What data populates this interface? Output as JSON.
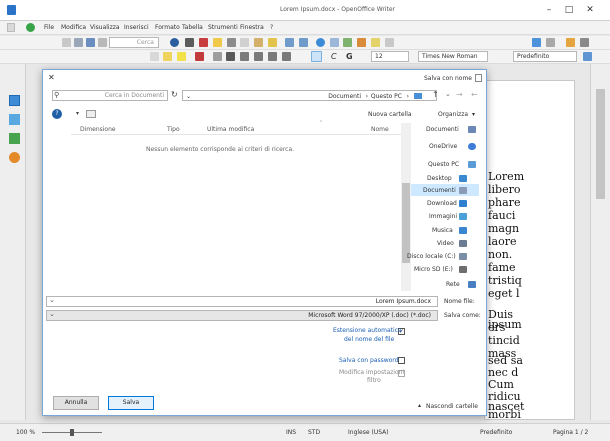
{
  "writer": {
    "title": "Lorem Ipsum.docx - OpenOffice Writer",
    "menu": [
      "File",
      "Modifica",
      "Visualizza",
      "Inserisci",
      "Formato",
      "Tabella",
      "Strumenti",
      "Finestra",
      "?"
    ],
    "search_placeholder": "Cerca",
    "style_value": "Predefinito",
    "font_value": "Times New Roman",
    "size_value": "12",
    "doc_lines": [
      "Lorem",
      "libero",
      "phare",
      "fauci",
      "magn",
      "laore",
      "non.",
      "fame",
      "tristiq",
      "eget l",
      "Duis",
      "ipsum",
      "ers",
      "tincid",
      "mass",
      "sed sa",
      "nec d",
      "Cum",
      "ridicu",
      "nascet",
      "morbi"
    ],
    "status": {
      "page": "Pagina 1 / 2",
      "style": "Predefinito",
      "language": "Inglese (USA)",
      "mode": "INS",
      "selection": "STD",
      "zoom": "100 %"
    }
  },
  "dialog": {
    "title": "Salva con nome",
    "path": [
      "Questo PC",
      "Documenti"
    ],
    "search_placeholder": "Cerca in Documenti",
    "organize_label": "Organizza",
    "new_folder_label": "Nuova cartella",
    "columns": [
      "Nome",
      "Ultima modifica",
      "Tipo",
      "Dimensione"
    ],
    "empty_message": "Nessun elemento corrisponde ai criteri di ricerca.",
    "nav_items": [
      {
        "label": "Documenti",
        "icon": "documents-folder-icon",
        "color": "#6c87b5"
      },
      {
        "label": "OneDrive",
        "icon": "onedrive-icon",
        "color": "#3d7dd8"
      },
      {
        "label": "Questo PC",
        "icon": "this-pc-icon",
        "color": "#5a9bd5"
      },
      {
        "label": "Desktop",
        "icon": "desktop-icon",
        "color": "#3a8ad1"
      },
      {
        "label": "Documenti",
        "icon": "documents-folder-icon",
        "color": "#8a9bb8"
      },
      {
        "label": "Download",
        "icon": "download-icon",
        "color": "#2f7fd0"
      },
      {
        "label": "Immagini",
        "icon": "pictures-icon",
        "color": "#4aa0d8"
      },
      {
        "label": "Musica",
        "icon": "music-icon",
        "color": "#3b86d1"
      },
      {
        "label": "Video",
        "icon": "video-icon",
        "color": "#6b7b92"
      },
      {
        "label": "Disco locale (C:)",
        "icon": "drive-icon",
        "color": "#7b8ea6"
      },
      {
        "label": "Micro SD (E:)",
        "icon": "sd-card-icon",
        "color": "#6e6e6e"
      },
      {
        "label": "Rete",
        "icon": "network-icon",
        "color": "#4a7fc1"
      }
    ],
    "file_name_label": "Nome file:",
    "file_name_value": "Lorem Ipsum.docx",
    "save_as_label": "Salva come:",
    "save_as_value": "Microsoft Word 97/2000/XP (.doc) (*.doc)",
    "auto_ext_label": "Estensione automatica",
    "auto_ext_label2": "del nome del file",
    "password_label": "Salva con password",
    "filter_label": "Modifica impostazioni",
    "filter_label2": "filtro",
    "hide_folders_label": "Nascondi cartelle",
    "save_button": "Salva",
    "cancel_button": "Annulla"
  }
}
